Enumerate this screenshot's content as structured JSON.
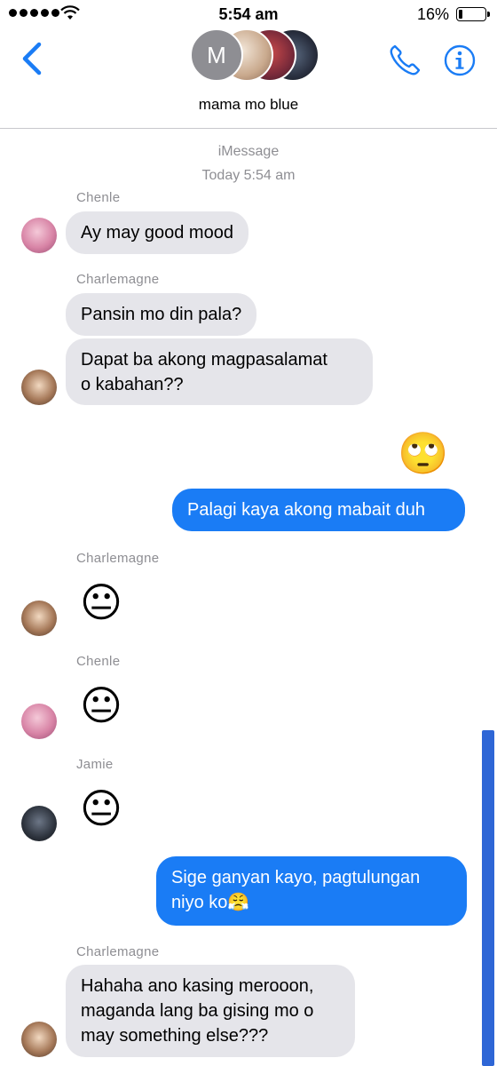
{
  "status_bar": {
    "time": "5:54 am",
    "battery_percent": "16%",
    "battery_level": 0.16
  },
  "header": {
    "group_name": "mama mo blue",
    "avatar_initial": "M",
    "back_icon": "chevron-left-icon",
    "call_icon": "phone-icon",
    "info_icon": "info-icon",
    "accent_color": "#1a7cf5"
  },
  "thread": {
    "service": "iMessage",
    "timestamp": "Today 5:54 am",
    "messages": [
      {
        "sender": "Chenle",
        "text": "Ay may good mood"
      },
      {
        "sender": "Charlemagne",
        "text": "Pansin mo din pala?"
      },
      {
        "text": "Dapat ba akong magpasalamat o kabahan??",
        "line1": "Dapat ba akong magpasalamat",
        "line2": "o kabahan??"
      },
      {
        "from_me": true,
        "emoji": "🙄"
      },
      {
        "from_me": true,
        "text": "Palagi kaya akong mabait duh"
      },
      {
        "sender": "Charlemagne",
        "emoji": "😐"
      },
      {
        "sender": "Chenle",
        "emoji": "😐"
      },
      {
        "sender": "Jamie",
        "emoji": "😐"
      },
      {
        "from_me": true,
        "text": "Sige ganyan kayo, pagtulungan niyo ko😤",
        "line1": "Sige ganyan kayo, pagtulungan",
        "line2": "niyo ko😤"
      },
      {
        "sender": "Charlemagne",
        "text": "Hahaha ano kasing merooon, maganda lang ba gising mo o may something else???",
        "line1": "Hahaha ano kasing merooon,",
        "line2": "maganda lang ba gising mo o",
        "line3": "may something else???"
      }
    ]
  }
}
